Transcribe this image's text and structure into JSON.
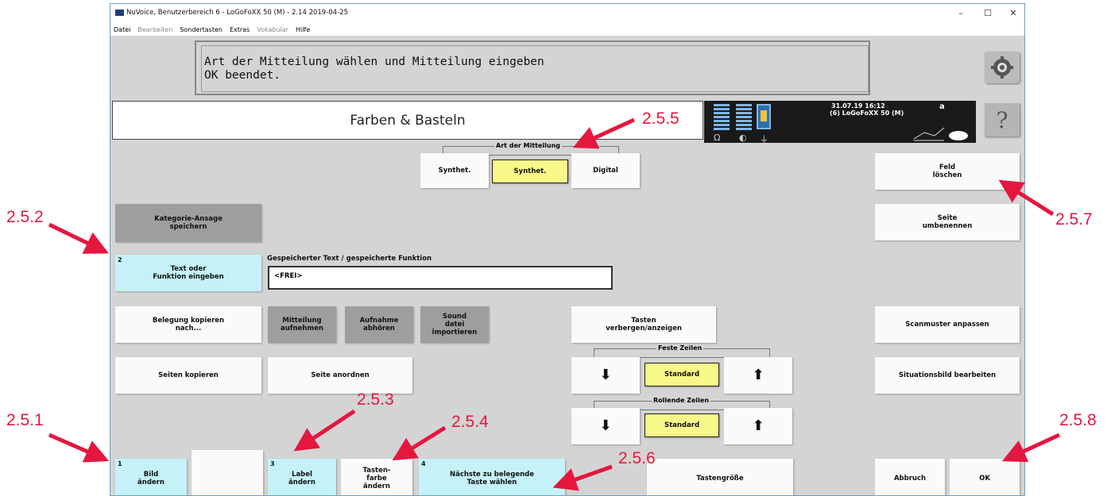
{
  "window": {
    "title": "NuVoice, Benutzerbereich 6 - LoGoFoXX 50 (M) - 2.14 2019-04-25",
    "controls": {
      "minimize": "–",
      "maximize": "☐",
      "close": "✕"
    }
  },
  "menu": [
    "Datei",
    "Bearbeiten",
    "Sondertasten",
    "Extras",
    "Vokabular",
    "Hilfe"
  ],
  "message": {
    "line1": "Art der Mitteilung wählen und Mitteilung eingeben",
    "line2": "OK beendet."
  },
  "page_title": "Farben & Basteln",
  "status": {
    "datetime": "31.07.19 16:12",
    "device": "(6) LoGoFoXX 50 (M)",
    "letter": "a",
    "help": "?"
  },
  "art_der_mitteilung": {
    "label": "Art der Mitteilung",
    "options": [
      "Synthet.",
      "Synthet.",
      "Digital"
    ]
  },
  "buttons": {
    "feld_loeschen": "Feld\nlöschen",
    "kategorie_ansage": "Kategorie-Ansage\nspeichern",
    "seite_umbenennen": "Seite\numbenennen",
    "text_oder_funktion": "Text oder\nFunktion eingeben",
    "text_oder_funktion_num": "2",
    "gespeicherter_label": "Gespeicherter Text / gespeicherte Funktion",
    "gespeicherter_value": "<FREI>",
    "belegung_kopieren": "Belegung kopieren\nnach...",
    "mitteilung_aufnehmen": "Mitteilung\naufnehmen",
    "aufnahme_abhoeren": "Aufnahme\nabhören",
    "sound_datei": "Sound\ndatei\nimportieren",
    "tasten_verbergen": "Tasten\nverbergen/anzeigen",
    "scanmuster": "Scanmuster anpassen",
    "seiten_kopieren": "Seiten kopieren",
    "seite_anordnen": "Seite anordnen",
    "situationsbild": "Situationsbild bearbeiten",
    "bild_aendern": "Bild\nändern",
    "bild_num": "1",
    "label_aendern": "Label\nändern",
    "label_num": "3",
    "tastenfarbe": "Tasten-\nfarbe\nändern",
    "naechste_taste": "Nächste zu belegende\nTaste wählen",
    "naechste_num": "4",
    "tastengroesse": "Tastengröße",
    "abbruch": "Abbruch",
    "ok": "OK"
  },
  "feste_zeilen": {
    "label": "Feste Zeilen",
    "down": "⬇",
    "standard": "Standard",
    "up": "⬆"
  },
  "rollende_zeilen": {
    "label": "Rollende Zeilen",
    "down": "⬇",
    "standard": "Standard",
    "up": "⬆"
  },
  "annotations": [
    "2.5.1",
    "2.5.2",
    "2.5.3",
    "2.5.4",
    "2.5.5",
    "2.5.6",
    "2.5.7",
    "2.5.8"
  ],
  "colors": {
    "annotation": "#e5173f",
    "cyan_button": "#c4f2f8",
    "yellow_button": "#f8f88a",
    "gray_button": "#9e9e9e",
    "background": "#d4d4d4"
  }
}
